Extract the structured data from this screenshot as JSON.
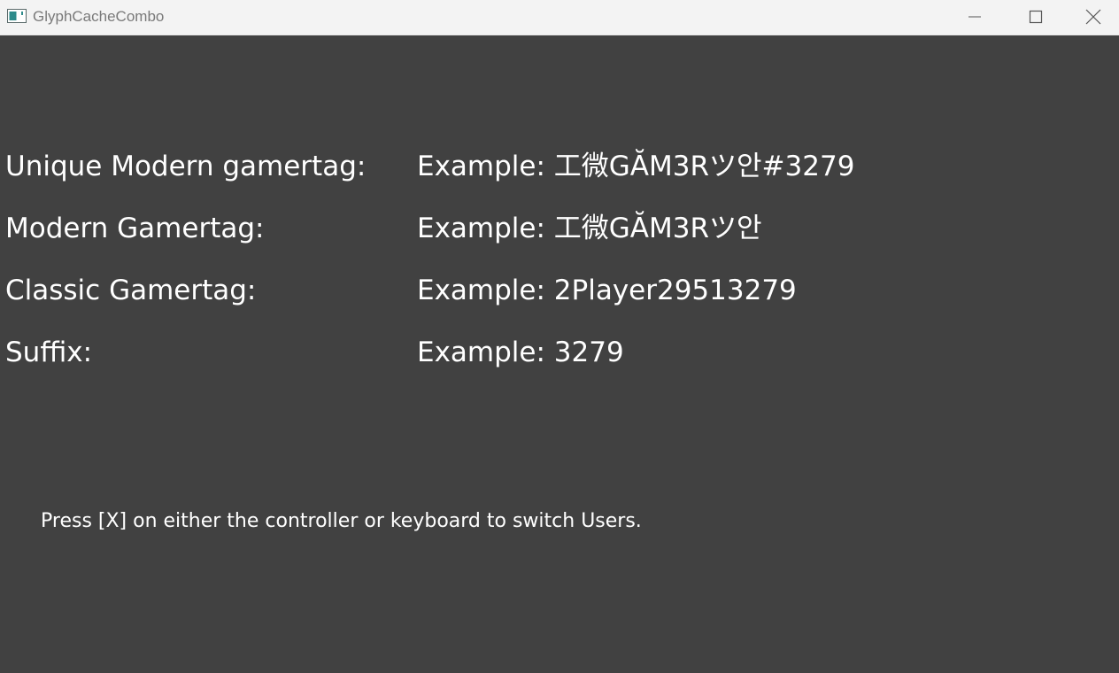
{
  "window": {
    "title": "GlyphCacheCombo",
    "controls": {
      "minimize_icon": "minimize-icon",
      "maximize_icon": "maximize-icon",
      "close_icon": "close-icon"
    }
  },
  "rows": [
    {
      "label": "Unique Modern gamertag:",
      "value": "Example: 工微GĂM3Rツ안#3279"
    },
    {
      "label": "Modern Gamertag:",
      "value": "Example: 工微GĂM3Rツ안"
    },
    {
      "label": "Classic Gamertag:",
      "value": "Example: 2Player29513279"
    },
    {
      "label": "Suffix:",
      "value": "Example: 3279"
    }
  ],
  "hint": "Press [X] on either the controller or keyboard to switch Users.",
  "colors": {
    "titlebar": "#f3f3f3",
    "background": "#414141",
    "text": "#ffffff"
  }
}
